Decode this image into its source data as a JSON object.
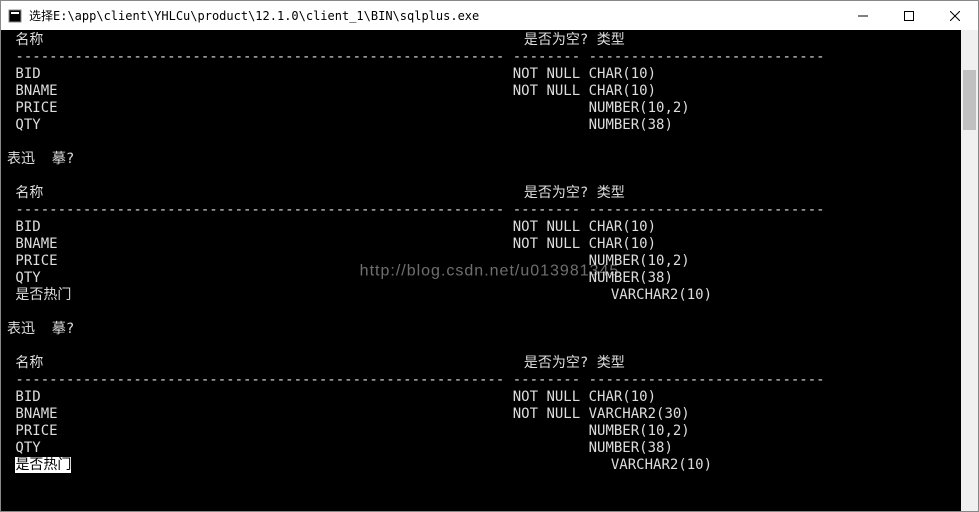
{
  "window": {
    "title": "选择E:\\app\\client\\YHLCu\\product\\12.1.0\\client_1\\BIN\\sqlplus.exe"
  },
  "header": {
    "name_col": "名称",
    "null_col": "是否为空? 类型",
    "dashes1": "----------------------------------------------------------",
    "dashes2": "-------- ----------------------------"
  },
  "block1": {
    "rows": [
      {
        "name": "BID",
        "nul": "NOT NULL",
        "type": "CHAR(10)"
      },
      {
        "name": "BNAME",
        "nul": "NOT NULL",
        "type": "CHAR(10)"
      },
      {
        "name": "PRICE",
        "nul": "",
        "type": "NUMBER(10,2)"
      },
      {
        "name": "QTY",
        "nul": "",
        "type": "NUMBER(38)"
      }
    ]
  },
  "section_label": "表迅  摹?",
  "block2": {
    "rows": [
      {
        "name": "BID",
        "nul": "NOT NULL",
        "type": "CHAR(10)"
      },
      {
        "name": "BNAME",
        "nul": "NOT NULL",
        "type": "CHAR(10)"
      },
      {
        "name": "PRICE",
        "nul": "",
        "type": "NUMBER(10,2)"
      },
      {
        "name": "QTY",
        "nul": "",
        "type": "NUMBER(38)"
      },
      {
        "name": "是否热门",
        "nul": "",
        "type": "VARCHAR2(10)"
      }
    ]
  },
  "block3": {
    "rows": [
      {
        "name": "BID",
        "nul": "NOT NULL",
        "type": "CHAR(10)"
      },
      {
        "name": "BNAME",
        "nul": "NOT NULL",
        "type": "VARCHAR2(30)"
      },
      {
        "name": "PRICE",
        "nul": "",
        "type": "NUMBER(10,2)"
      },
      {
        "name": "QTY",
        "nul": "",
        "type": "NUMBER(38)"
      },
      {
        "name": "是否热门",
        "nul": "",
        "type": "VARCHAR2(10)"
      }
    ]
  },
  "watermark": "http://blog.csdn.net/u013981345"
}
